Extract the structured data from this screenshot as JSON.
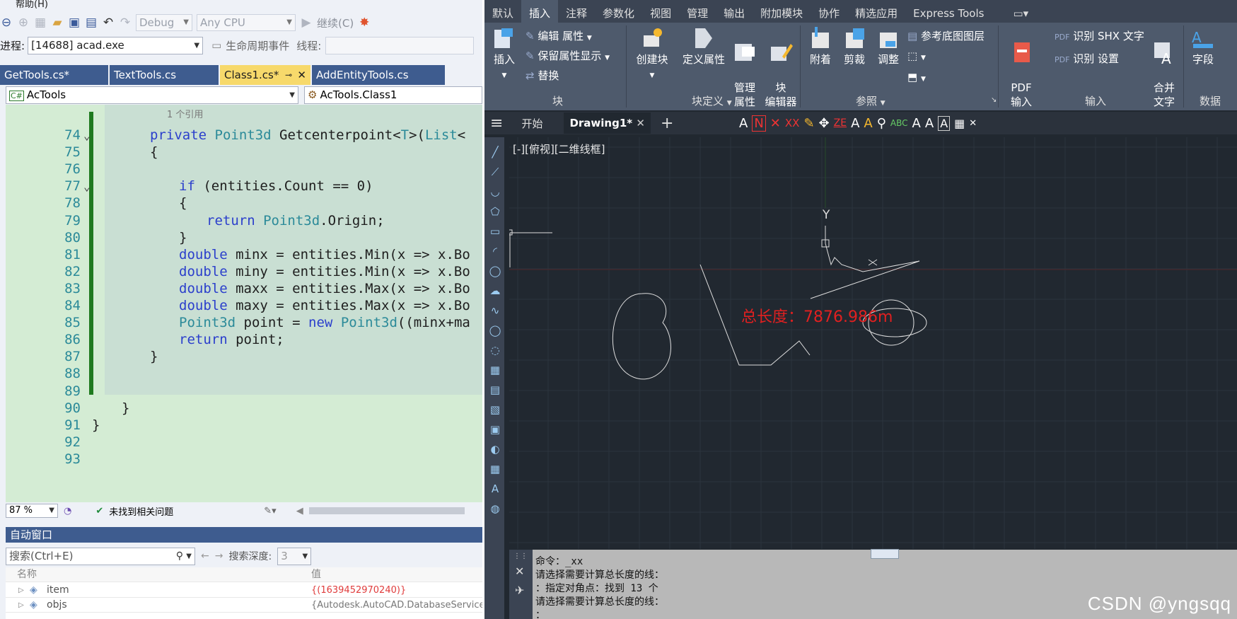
{
  "vs": {
    "menu_help": "帮助(H)",
    "config": "Debug",
    "platform": "Any CPU",
    "continue_label": "继续(C)",
    "process_label": "进程:",
    "process_value": "[14688] acad.exe",
    "lifecycle_label": "生命周期事件",
    "thread_label": "线程:",
    "tabs": [
      {
        "label": "GetTools.cs*"
      },
      {
        "label": "TextTools.cs"
      },
      {
        "label": "Class1.cs*"
      },
      {
        "label": "AddEntityTools.cs"
      }
    ],
    "nav_left": "AcTools",
    "nav_right": "AcTools.Class1",
    "codelens": "1 个引用",
    "lines": [
      {
        "n": "74",
        "text": "private Point3d Getcenterpoint<T>(List<"
      },
      {
        "n": "75",
        "text": "{"
      },
      {
        "n": "76",
        "text": ""
      },
      {
        "n": "77",
        "text": "if (entities.Count == 0)"
      },
      {
        "n": "78",
        "text": "{"
      },
      {
        "n": "79",
        "text": "return Point3d.Origin;"
      },
      {
        "n": "80",
        "text": "}"
      },
      {
        "n": "81",
        "text": "double minx = entities.Min(x => x.Bo"
      },
      {
        "n": "82",
        "text": "double miny = entities.Min(x => x.Bo"
      },
      {
        "n": "83",
        "text": "double maxx = entities.Max(x => x.Bo"
      },
      {
        "n": "84",
        "text": "double maxy = entities.Max(x => x.Bo"
      },
      {
        "n": "85",
        "text": "Point3d point = new Point3d((minx+ma"
      },
      {
        "n": "86",
        "text": "return point;"
      },
      {
        "n": "87",
        "text": "}"
      },
      {
        "n": "88",
        "text": ""
      },
      {
        "n": "89",
        "text": ""
      },
      {
        "n": "90",
        "text": "}"
      },
      {
        "n": "91",
        "text": "}"
      },
      {
        "n": "92",
        "text": ""
      },
      {
        "n": "93",
        "text": ""
      }
    ],
    "zoom": "87 %",
    "status_msg": "未找到相关问题",
    "auto_title": "自动窗口",
    "search_placeholder": "搜索(Ctrl+E)",
    "depth_label": "搜索深度:",
    "depth_value": "3",
    "col_name": "名称",
    "col_value": "值",
    "rows": [
      {
        "name": "item",
        "value": "{(1639452970240)}"
      },
      {
        "name": "objs",
        "value": "{Autodesk.AutoCAD.DatabaseServices"
      }
    ]
  },
  "cad": {
    "ribbon_tabs": [
      "默认",
      "插入",
      "注释",
      "参数化",
      "视图",
      "管理",
      "输出",
      "附加模块",
      "协作",
      "精选应用",
      "Express Tools"
    ],
    "active_tab": "插入",
    "btn_insert": "插入",
    "btn_edit_attr": "编辑 属性",
    "btn_keep_attr": "保留属性显示",
    "btn_replace": "替换",
    "btn_create_block": "创建块",
    "btn_define_attr": "定义属性",
    "btn_manage_attr": "管理\n属性",
    "btn_block_editor": "块\n编辑器",
    "btn_attach": "附着",
    "btn_clip": "剪裁",
    "btn_adjust": "调整",
    "btn_ref_layer": "参考底图图层",
    "btn_pdf": "PDF\n输入",
    "btn_shx": "识别 SHX 文字",
    "btn_settings": "识别 设置",
    "btn_merge_text": "合并\n文字",
    "btn_field": "字段",
    "panel_block": "块",
    "panel_block_def": "块定义",
    "panel_ref": "参照",
    "panel_input": "输入",
    "panel_data": "数据",
    "tab_start": "开始",
    "tab_drawing": "Drawing1*",
    "view_label": "[-][俯视][二维线框]",
    "total_length": "总长度：7876.986m",
    "y_axis": "Y",
    "cmd_lines": [
      "命令：_xx",
      "请选择需要计算总长度的线：",
      "：指定对角点：找到 13 个",
      "请选择需要计算总长度的线：",
      "："
    ],
    "watermark": "CSDN @yngsqq"
  }
}
